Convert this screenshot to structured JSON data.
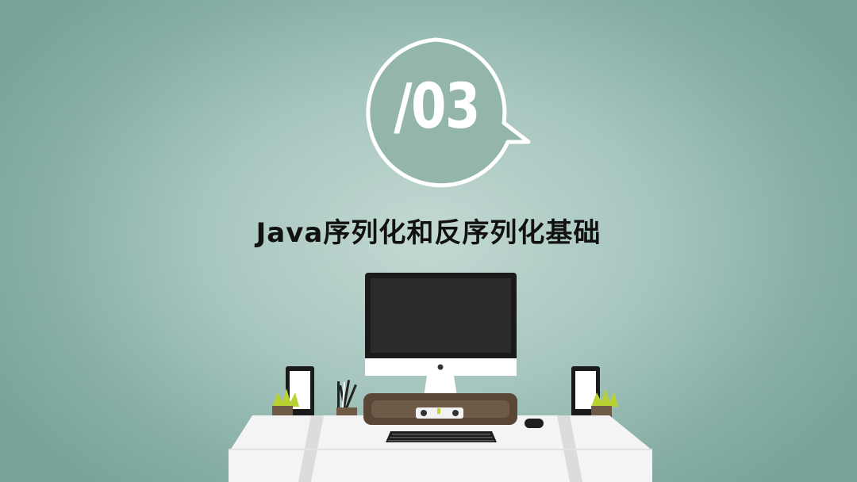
{
  "badge": {
    "number": "/03"
  },
  "title": "Java序列化和反序列化基础",
  "colors": {
    "background_center": "#c3d8d3",
    "background_edge": "#7aa399",
    "badge_fill": "#93b5ac",
    "title_text": "#111111",
    "desk": "#f4f4f4",
    "monitor_screen": "#222222"
  },
  "scene": {
    "icons": [
      "monitor-icon",
      "speaker-icon",
      "plant-icon",
      "pencil-cup-icon",
      "keyboard-icon",
      "mouse-icon",
      "desk-icon"
    ]
  }
}
